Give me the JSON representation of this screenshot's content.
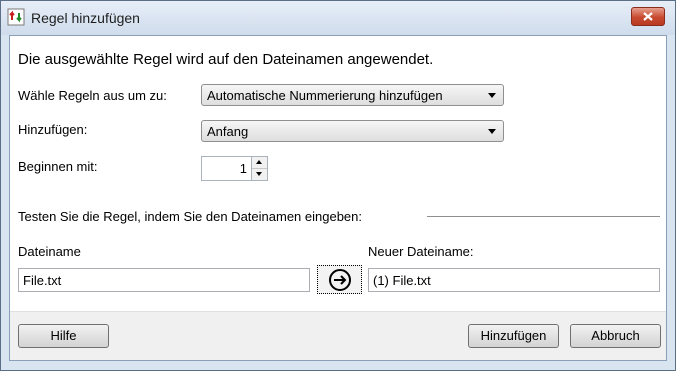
{
  "window": {
    "title": "Regel hinzufügen"
  },
  "main": {
    "heading": "Die ausgewählte Regel wird auf den Dateinamen angewendet.",
    "rule_label": "Wähle Regeln aus um zu:",
    "rule_value": "Automatische Nummerierung hinzufügen",
    "add_label": "Hinzufügen:",
    "add_value": "Anfang",
    "start_label": "Beginnen mit:",
    "start_value": "1",
    "test_heading": "Testen Sie die Regel, indem Sie den Dateinamen eingeben:",
    "filename_label": "Dateiname",
    "filename_value": "File.txt",
    "new_filename_label": "Neuer Dateiname:",
    "new_filename_value": "(1) File.txt"
  },
  "footer": {
    "help": "Hilfe",
    "add": "Hinzufügen",
    "cancel": "Abbruch"
  },
  "colors": {
    "titlebar": "#d9e4f1",
    "close": "#c7492f",
    "footer": "#f0f0f0"
  },
  "icons": {
    "app": "rename-rule-icon",
    "close": "close-icon",
    "go": "arrow-right-circle-icon"
  }
}
